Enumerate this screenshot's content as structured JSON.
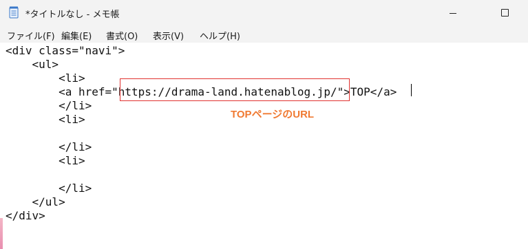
{
  "window": {
    "title": "*タイトルなし - メモ帳",
    "app_icon": "notepad-icon"
  },
  "menu": {
    "items": [
      "ファイル(F)",
      "編集(E)",
      "書式(O)",
      "表示(V)",
      "ヘルプ(H)"
    ]
  },
  "editor": {
    "lines": [
      "<div class=\"navi\">",
      "    <ul>",
      "        <li>",
      "        <a href=\"https://drama-land.hatenablog.jp/\">TOP</a>",
      "        </li>",
      "        <li>",
      "",
      "        </li>",
      "        <li>",
      "",
      "        </li>",
      "    </ul>",
      "</div>"
    ]
  },
  "annotation": {
    "label": "TOPページのURL",
    "color": "#f07a32",
    "box_color": "#e0312f"
  }
}
